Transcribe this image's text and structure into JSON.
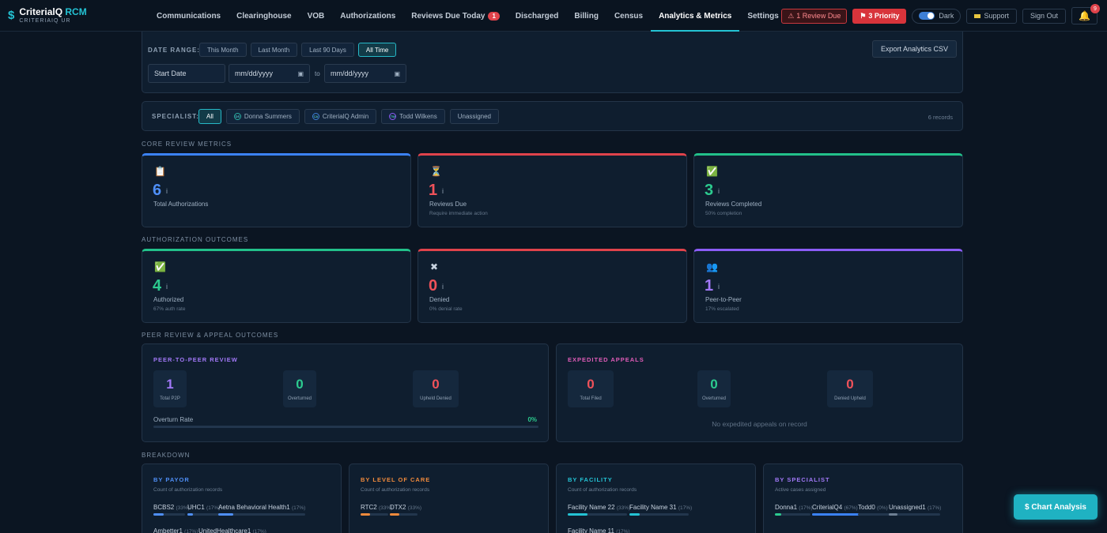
{
  "app": {
    "logo_main": "CriterialQ",
    "logo_accent": "RCM",
    "logo_sub": "CRITERIAIQ UR"
  },
  "nav": [
    "Communications",
    "Clearinghouse",
    "VOB",
    "Authorizations",
    "Reviews Due Today",
    "Discharged",
    "Billing",
    "Census",
    "Analytics & Metrics",
    "Settings"
  ],
  "nav_badge": "1",
  "header": {
    "review_due": "1 Review Due",
    "priority": "3 Priority",
    "dark": "Dark",
    "support": "Support",
    "signout": "Sign Out",
    "bell_count": "9"
  },
  "date_range": {
    "label": "DATE RANGE:",
    "options": [
      "This Month",
      "Last Month",
      "Last 90 Days",
      "All Time"
    ],
    "active": "All Time",
    "start": "Start Date",
    "date1": "mm/dd/yyyy",
    "to": "to",
    "date2": "mm/dd/yyyy",
    "export": "Export Analytics CSV"
  },
  "specialist": {
    "label": "SPECIALIST:",
    "all": "All",
    "people": [
      {
        "initials": "DS",
        "name": "Donna Summers"
      },
      {
        "initials": "CA",
        "name": "CriterialQ Admin"
      },
      {
        "initials": "TW",
        "name": "Todd Wilkens"
      }
    ],
    "unassigned": "Unassigned",
    "records": "6 records"
  },
  "core": {
    "title": "CORE REVIEW METRICS",
    "cards": [
      {
        "icon": "📋",
        "value": "6",
        "label": "Total Authorizations",
        "sub": "",
        "color": "#3b82f6",
        "value_color": "#4f8ff7"
      },
      {
        "icon": "⏳",
        "value": "1",
        "label": "Reviews Due",
        "sub": "Require immediate action",
        "color": "#e0434b",
        "value_color": "#f0525a"
      },
      {
        "icon": "✅",
        "value": "3",
        "label": "Reviews Completed",
        "sub": "50% completion",
        "color": "#22c08a",
        "value_color": "#2ccb8f"
      }
    ]
  },
  "outcomes": {
    "title": "AUTHORIZATION OUTCOMES",
    "cards": [
      {
        "icon": "✅",
        "value": "4",
        "label": "Authorized",
        "sub": "67% auth rate",
        "color": "#22c08a",
        "value_color": "#2ccb8f"
      },
      {
        "icon": "✖",
        "value": "0",
        "label": "Denied",
        "sub": "0% denial rate",
        "color": "#e0434b",
        "value_color": "#f0525a"
      },
      {
        "icon": "👥",
        "value": "1",
        "label": "Peer-to-Peer",
        "sub": "17% escalated",
        "color": "#8b5cf6",
        "value_color": "#a178f7"
      }
    ]
  },
  "peer": {
    "title": "PEER REVIEW & APPEAL OUTCOMES",
    "p2p": {
      "head": "PEER-TO-PEER REVIEW",
      "stats": [
        {
          "v": "1",
          "l": "Total P2P",
          "c": "#a178f7"
        },
        {
          "v": "0",
          "l": "Overturned",
          "c": "#2ccb8f"
        },
        {
          "v": "0",
          "l": "Upheld Denied",
          "c": "#f0525a"
        }
      ],
      "rate_label": "Overturn Rate",
      "rate_value": "0%"
    },
    "appeals": {
      "head": "EXPEDITED APPEALS",
      "stats": [
        {
          "v": "0",
          "l": "Total Filed",
          "c": "#f0525a"
        },
        {
          "v": "0",
          "l": "Overturned",
          "c": "#2ccb8f"
        },
        {
          "v": "0",
          "l": "Denied Upheld",
          "c": "#f0525a"
        }
      ],
      "empty": "No expedited appeals on record"
    }
  },
  "breakdown": {
    "title": "BREAKDOWN",
    "payor": {
      "head": "BY PAYOR",
      "sub": "Count of authorization records",
      "items": [
        {
          "name": "BCBS",
          "count": "2",
          "pct": "(33%)",
          "frac": 0.33
        },
        {
          "name": "UHC",
          "count": "1",
          "pct": "(17%)",
          "frac": 0.17
        },
        {
          "name": "Aetna Behavioral Health",
          "count": "1",
          "pct": "(17%)",
          "frac": 0.17
        },
        {
          "name": "Ambetter",
          "count": "1",
          "pct": "(17%)",
          "frac": 0.17
        },
        {
          "name": "UnitedHealthcare",
          "count": "1",
          "pct": "(17%)",
          "frac": 0.17
        }
      ]
    },
    "level": {
      "head": "BY LEVEL OF CARE",
      "sub": "Count of authorization records",
      "items": [
        {
          "name": "RTC",
          "count": "2",
          "pct": "(33%)",
          "frac": 0.33
        },
        {
          "name": "DTX",
          "count": "2",
          "pct": "(33%)",
          "frac": 0.33
        }
      ]
    },
    "facility": {
      "head": "BY FACILITY",
      "sub": "Count of authorization records",
      "items": [
        {
          "name": "Facility Name 2",
          "count": "2",
          "pct": "(33%)",
          "frac": 0.33
        },
        {
          "name": "Facility Name 3",
          "count": "1",
          "pct": "(17%)",
          "frac": 0.17
        },
        {
          "name": "Facility Name 1",
          "count": "1",
          "pct": "(17%)",
          "frac": 0.17
        }
      ]
    },
    "specialist": {
      "head": "BY SPECIALIST",
      "sub": "Active cases assigned",
      "items": [
        {
          "name": "Donna",
          "count": "1",
          "pct": "(17%)",
          "frac": 0.17
        },
        {
          "name": "CriterialQ",
          "count": "4",
          "pct": "(67%)",
          "frac": 0.67
        },
        {
          "name": "Todd",
          "count": "0",
          "pct": "(0%)",
          "frac": 0
        },
        {
          "name": "Unassigned",
          "count": "1",
          "pct": "(17%)",
          "frac": 0.17
        }
      ]
    }
  },
  "chart_button": "$ Chart Analysis"
}
